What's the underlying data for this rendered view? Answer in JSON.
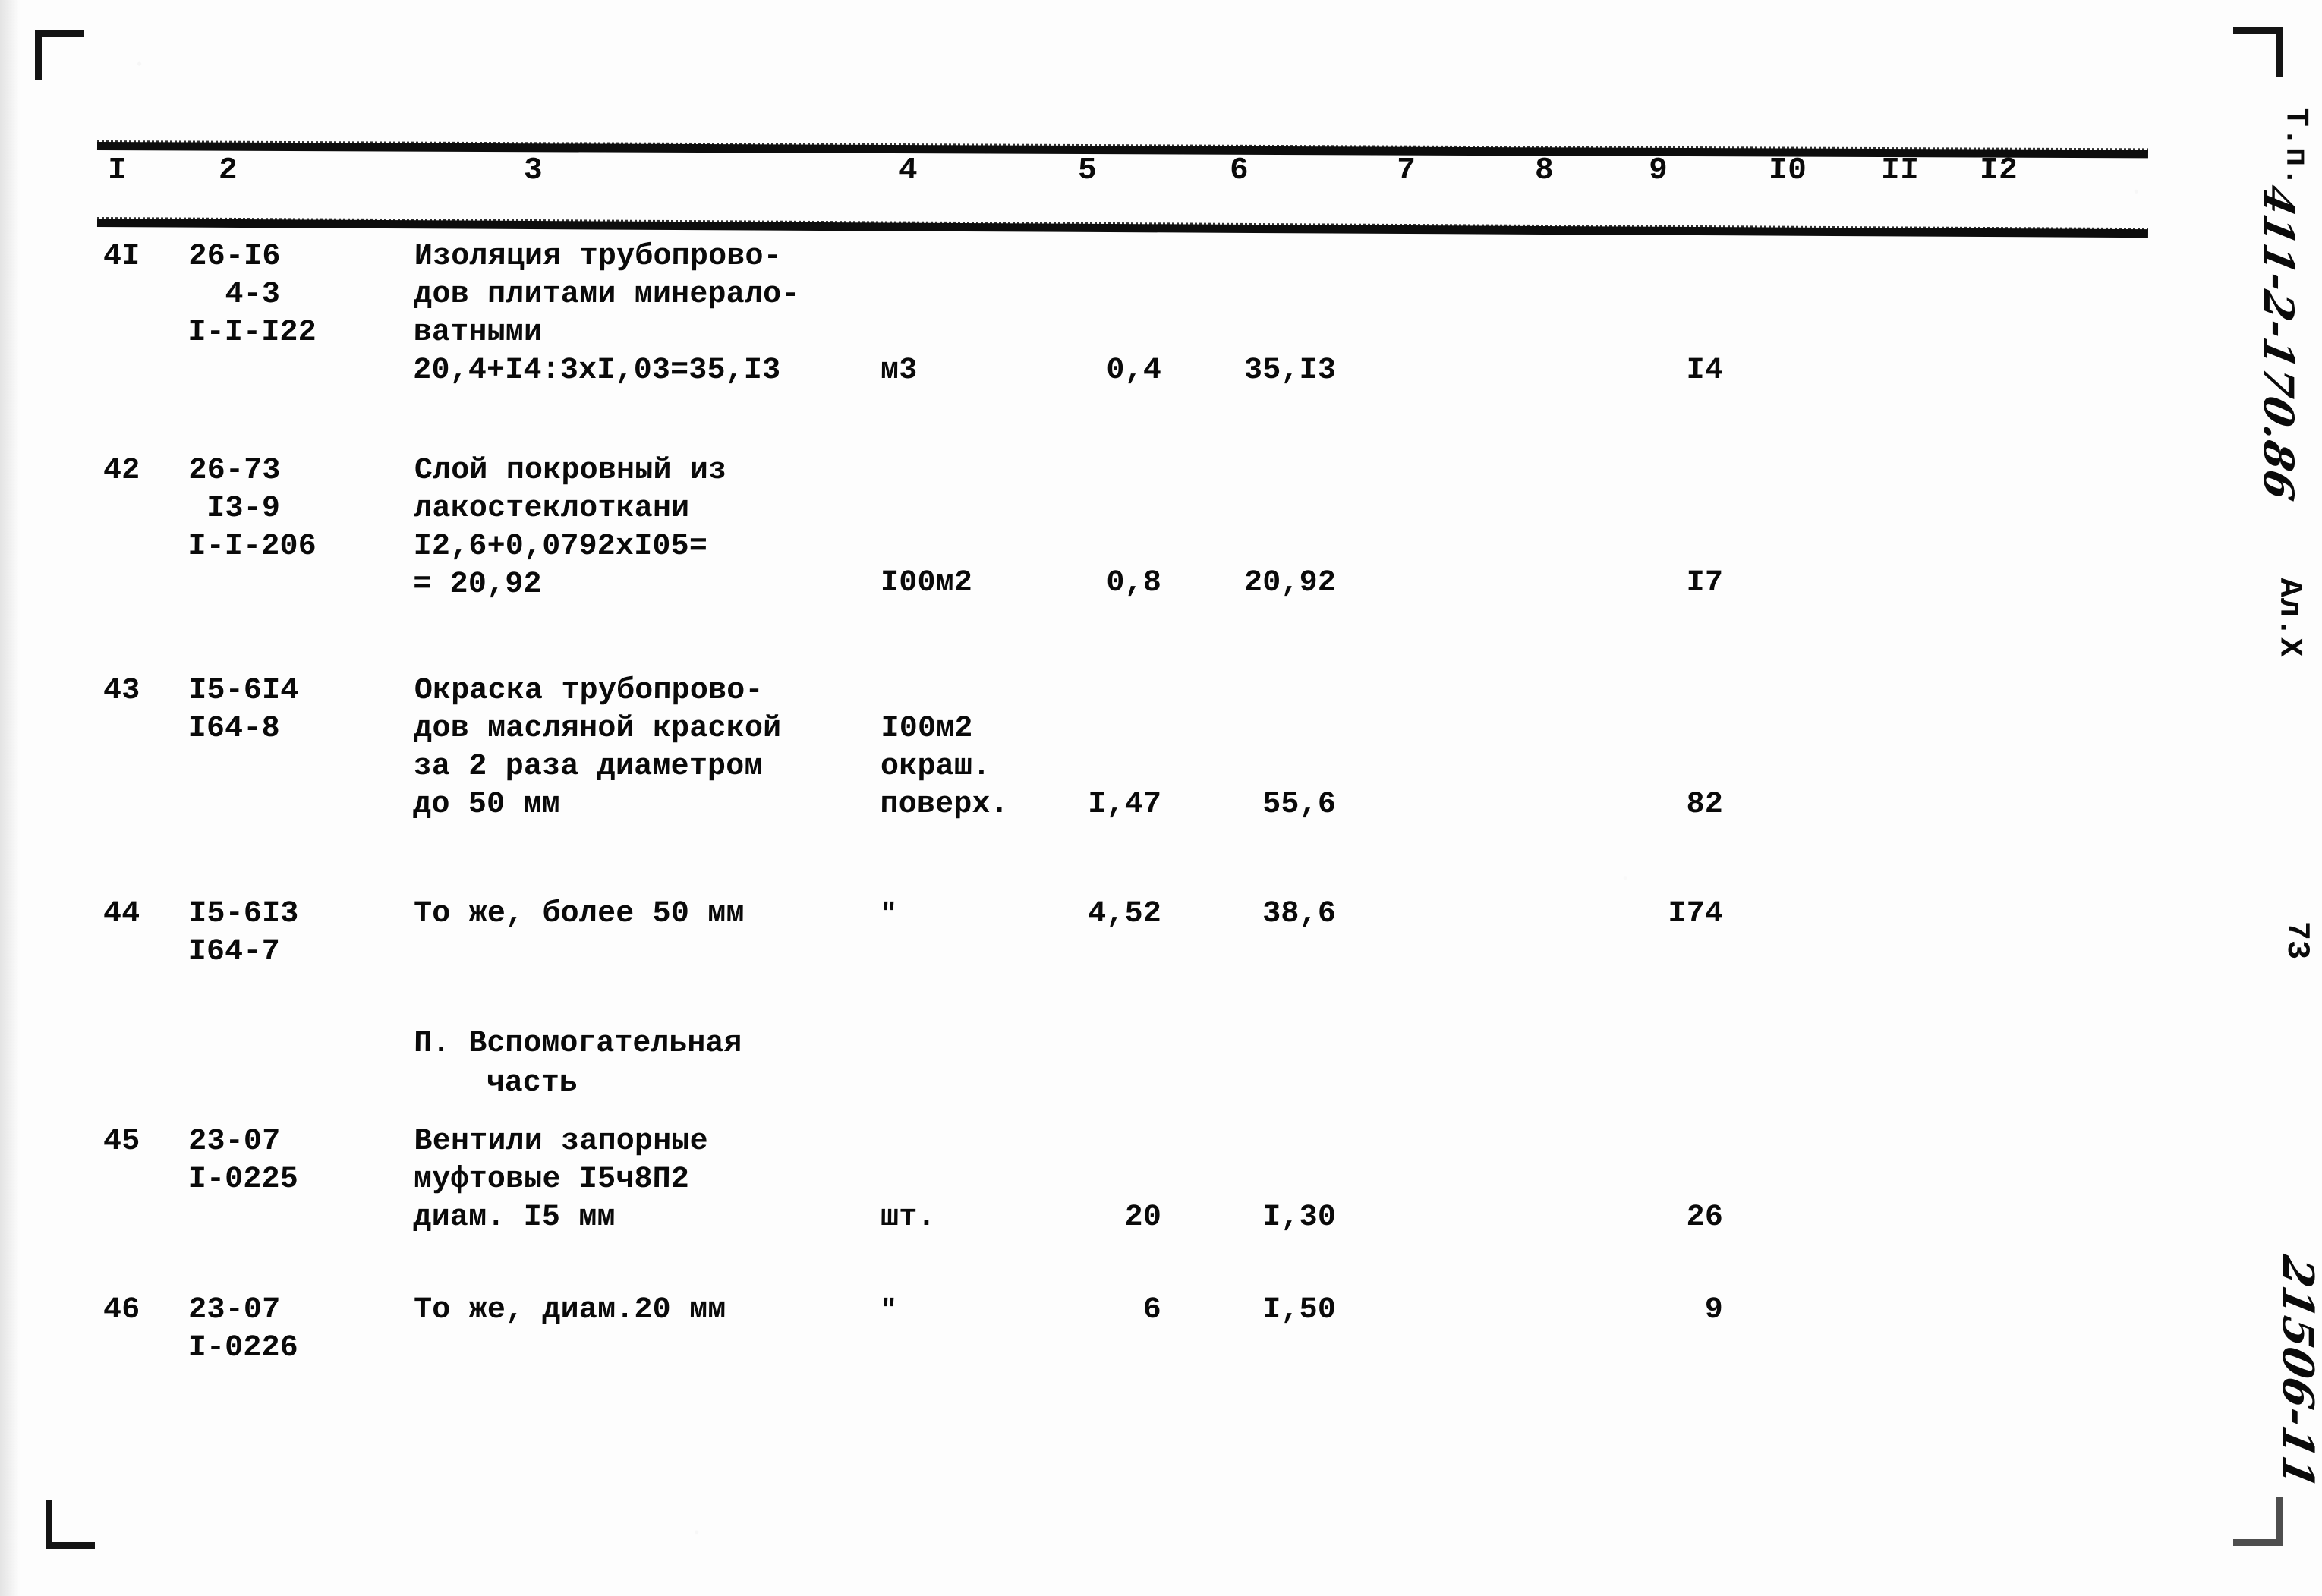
{
  "document": {
    "type": "construction-estimate-sheet",
    "column_headers": [
      "I",
      "2",
      "3",
      "4",
      "5",
      "6",
      "7",
      "8",
      "9",
      "I0",
      "II",
      "I2"
    ]
  },
  "margin": {
    "type_label": "Т.п.",
    "series_code": "411-2-170.86",
    "album_label": "Ал.Х",
    "page_number": "73",
    "order_number": "21506-11",
    "corner_mark": "registration-corner"
  },
  "rows": [
    {
      "num": "4I",
      "code": "26-I6\n  4-3\nI-I-I22",
      "description": "Изоляция трубопрово-\nдов плитами минерало-\nватными\n20,4+I4:3xI,03=35,I3",
      "unit": "м3",
      "qty": "0,4",
      "price": "35,I3",
      "total": "I4"
    },
    {
      "num": "42",
      "code": "26-73\n I3-9\nI-I-206",
      "description": "Слой покровный из\nлакостеклоткани\nI2,6+0,0792xI05=\n= 20,92",
      "unit": "I00м2",
      "qty": "0,8",
      "price": "20,92",
      "total": "I7"
    },
    {
      "num": "43",
      "code": "I5-6I4\nI64-8",
      "description": "Окраска трубопрово-\nдов масляной краской\nза 2 раза диаметром\nдо 50 мм",
      "unit": "I00м2\nокраш.\nповерх.",
      "qty": "I,47",
      "price": "55,6",
      "total": "82"
    },
    {
      "num": "44",
      "code": "I5-6I3\nI64-7",
      "description": "То же, более 50 мм",
      "unit": "\"",
      "qty": "4,52",
      "price": "38,6",
      "total": "I74"
    },
    {
      "num": "45",
      "code": "23-07\nI-0225",
      "description": "Вентили запорные\nмуфтовые I5ч8П2\nдиам. I5 мм",
      "unit": "шт.",
      "qty": "20",
      "price": "I,30",
      "total": "26"
    },
    {
      "num": "46",
      "code": "23-07\nI-0226",
      "description": "То же, диам.20 мм",
      "unit": "\"",
      "qty": "6",
      "price": "I,50",
      "total": "9"
    }
  ],
  "section_heading": "П. Вспомогательная\n    часть"
}
